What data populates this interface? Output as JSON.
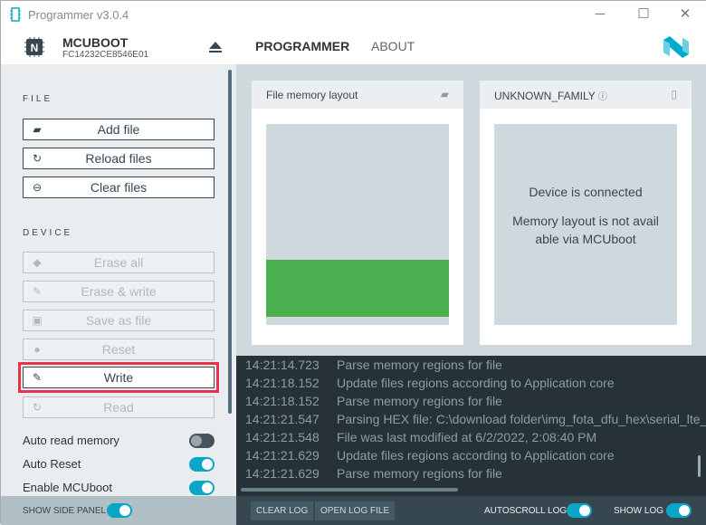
{
  "window": {
    "title": "Programmer v3.0.4",
    "minimize": "─",
    "maximize": "☐",
    "close": "✕"
  },
  "device": {
    "name": "MCUBOOT",
    "serial": "FC14232CE8546E01"
  },
  "nav": {
    "programmer": "PROGRAMMER",
    "about": "ABOUT"
  },
  "sidebar": {
    "file_title": "FILE",
    "file_buttons": [
      {
        "label": "Add file",
        "icon": "folder-open-icon"
      },
      {
        "label": "Reload files",
        "icon": "reload-icon"
      },
      {
        "label": "Clear files",
        "icon": "minus-circle-icon"
      }
    ],
    "device_title": "DEVICE",
    "device_buttons": [
      {
        "label": "Erase all",
        "enabled": false
      },
      {
        "label": "Erase & write",
        "enabled": false
      },
      {
        "label": "Save as file",
        "enabled": false
      },
      {
        "label": "Reset",
        "enabled": false
      },
      {
        "label": "Write",
        "enabled": true,
        "highlighted": true
      },
      {
        "label": "Read",
        "enabled": false
      }
    ],
    "toggles": [
      {
        "label": "Auto read memory",
        "on": false
      },
      {
        "label": "Auto Reset",
        "on": true
      },
      {
        "label": "Enable MCUboot",
        "on": true
      }
    ],
    "show_side_panel": {
      "label": "SHOW SIDE PANEL",
      "on": true
    }
  },
  "cards": {
    "file": {
      "title": "File memory layout"
    },
    "device": {
      "title": "UNKNOWN_FAMILY",
      "line1": "Device is connected",
      "line2": "Memory layout is not avail",
      "line3": "able via MCUboot"
    }
  },
  "log": {
    "entries": [
      {
        "time": "14:21:14.723",
        "msg": "Parse memory regions for file"
      },
      {
        "time": "14:21:18.152",
        "msg": "Update files regions according to Application core"
      },
      {
        "time": "14:21:18.152",
        "msg": "Parse memory regions for file"
      },
      {
        "time": "14:21:21.547",
        "msg": "Parsing HEX file: C:\\download folder\\img_fota_dfu_hex\\serial_lte_modem"
      },
      {
        "time": "14:21:21.548",
        "msg": "File was last modified at 6/2/2022, 2:08:40 PM"
      },
      {
        "time": "14:21:21.629",
        "msg": "Update files regions according to Application core"
      },
      {
        "time": "14:21:21.629",
        "msg": "Parse memory regions for file"
      }
    ],
    "clear": "CLEAR LOG",
    "open": "OPEN LOG FILE",
    "autoscroll": {
      "label": "AUTOSCROLL LOG",
      "on": true
    },
    "show": {
      "label": "SHOW LOG",
      "on": true
    }
  },
  "colors": {
    "accent": "#0aa6c8",
    "highlight": "#e8334a",
    "memory_green": "#4caf50"
  }
}
